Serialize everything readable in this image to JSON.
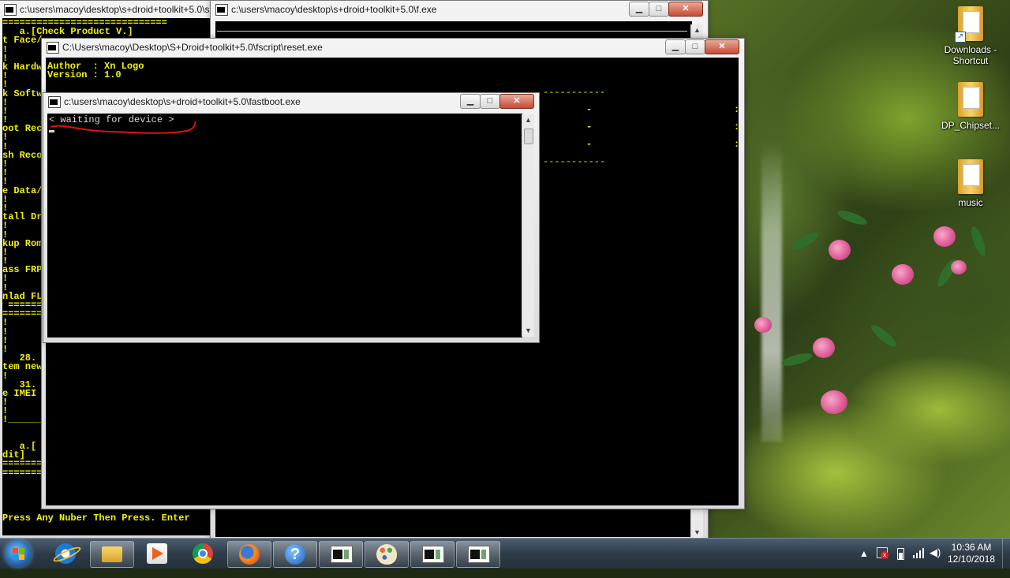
{
  "desktop": {
    "icons": [
      {
        "label_line1": "Downloads -",
        "label_line2": "Shortcut"
      },
      {
        "label_line1": "DP_Chipset...",
        "label_line2": ""
      },
      {
        "label_line1": "music",
        "label_line2": ""
      }
    ]
  },
  "windows": {
    "back_console": {
      "title": "c:\\users\\macoy\\desktop\\s+droid+toolkit+5.0\\s-d",
      "lines": [
        "=============================",
        "   a.[Check Product V.]",
        "t Face/",
        "!",
        "!",
        "k Hardw",
        "!",
        "!",
        "k Softw",
        "!",
        "!",
        "!",
        "oot Rec",
        "!",
        "!",
        "sh Reco",
        "!",
        "!",
        "!",
        "e Data/",
        "!",
        "!",
        "tall Dr",
        "!",
        "!",
        "kup Rom",
        "!",
        "!",
        "ass FRP",
        "!",
        "!",
        "nlad FL",
        " ======",
        "=======",
        "!",
        "!",
        "!",
        "!",
        "   28.",
        "tem new",
        "!",
        "   31.",
        "e IMEI",
        "!",
        "!",
        "!______",
        "",
        "",
        "   a.[",
        "dit]",
        "=======",
        "======="
      ],
      "prompt": "Press Any Nuber Then Press. Enter"
    },
    "f_exe": {
      "title": "c:\\users\\macoy\\desktop\\s+droid+toolkit+5.0\\f.exe",
      "min": "▁",
      "max": "□",
      "close": "✕"
    },
    "reset_exe": {
      "title": "C:\\Users\\macoy\\Desktop\\S+Droid+toolkit+5.0\\fscript\\reset.exe",
      "line1": "Author  : Xn Logo",
      "line2": "Version : 1.0",
      "min": "▁",
      "max": "□",
      "close": "✕"
    },
    "fastboot_exe": {
      "title": "c:\\users\\macoy\\desktop\\s+droid+toolkit+5.0\\fastboot.exe",
      "line1": "< waiting for device >",
      "min": "▁",
      "max": "□",
      "close": "✕"
    }
  },
  "taskbar": {
    "start_icon": "windows-orb-icon",
    "buttons": [
      {
        "icon": "internet-explorer-icon",
        "active": false
      },
      {
        "icon": "file-explorer-icon",
        "active": true
      },
      {
        "icon": "media-player-icon",
        "active": false
      },
      {
        "icon": "chrome-icon",
        "active": false
      },
      {
        "icon": "firefox-icon",
        "active": true
      },
      {
        "icon": "help-icon",
        "active": true
      },
      {
        "icon": "console-window-icon",
        "active": true
      },
      {
        "icon": "paint-icon",
        "active": true
      },
      {
        "icon": "console-window-icon",
        "active": true
      },
      {
        "icon": "console-window-icon",
        "active": true
      }
    ],
    "clock": {
      "time": "10:36 AM",
      "date": "12/10/2018"
    }
  },
  "colors": {
    "console_text_yellow": "#f2f20a",
    "annotation_red": "#e01010",
    "taskbar": "#2f3c48"
  }
}
